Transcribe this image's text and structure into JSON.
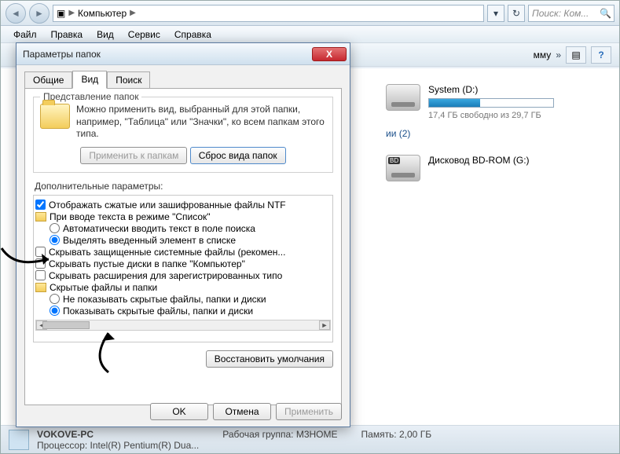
{
  "breadcrumb": {
    "root_glyph": "▣",
    "item": "Компьютер"
  },
  "search": {
    "placeholder": "Поиск: Ком..."
  },
  "menu": {
    "file": "Файл",
    "edit": "Правка",
    "view": "Вид",
    "tools": "Сервис",
    "help": "Справка"
  },
  "toolbar": {
    "more": "»",
    "truncated": "мму"
  },
  "drives": {
    "system": {
      "name": "System (D:)",
      "free": "17,4 ГБ свободно из 29,7 ГБ",
      "pct": 41
    },
    "cat": "ии (2)",
    "bdrom": {
      "name": "Дисковод BD-ROM (G:)",
      "badge": "BD"
    }
  },
  "status": {
    "pc": "VOKOVE-PC",
    "wg_label": "Рабочая группа:",
    "wg_val": "M3HOME",
    "cpu_label": "Процессор:",
    "cpu_val": "Intel(R) Pentium(R) Dua...",
    "mem_label": "Память:",
    "mem_val": "2,00 ГБ"
  },
  "dialog": {
    "title": "Параметры папок",
    "tabs": {
      "general": "Общие",
      "view": "Вид",
      "search": "Поиск"
    },
    "group_title": "Представление папок",
    "group_text": "Можно применить вид, выбранный для этой папки, например, \"Таблица\" или \"Значки\", ко всем папкам этого типа.",
    "apply_folders": "Применить к папкам",
    "reset_folders": "Сброс вида папок",
    "adv_label": "Дополнительные параметры:",
    "items": {
      "i0": "Отображать сжатые или зашифрованные файлы NTF",
      "i1": "При вводе текста в режиме \"Список\"",
      "i1a": "Автоматически вводить текст в поле поиска",
      "i1b": "Выделять введенный элемент в списке",
      "i2": "Скрывать защищенные системные файлы (рекомен...",
      "i3": "Скрывать пустые диски в папке \"Компьютер\"",
      "i4": "Скрывать расширения для зарегистрированных типо",
      "i5": "Скрытые файлы и папки",
      "i5a": "Не показывать скрытые файлы, папки и диски",
      "i5b": "Показывать скрытые файлы, папки и диски"
    },
    "restore": "Восстановить умолчания",
    "ok": "OK",
    "cancel": "Отмена",
    "apply": "Применить"
  }
}
